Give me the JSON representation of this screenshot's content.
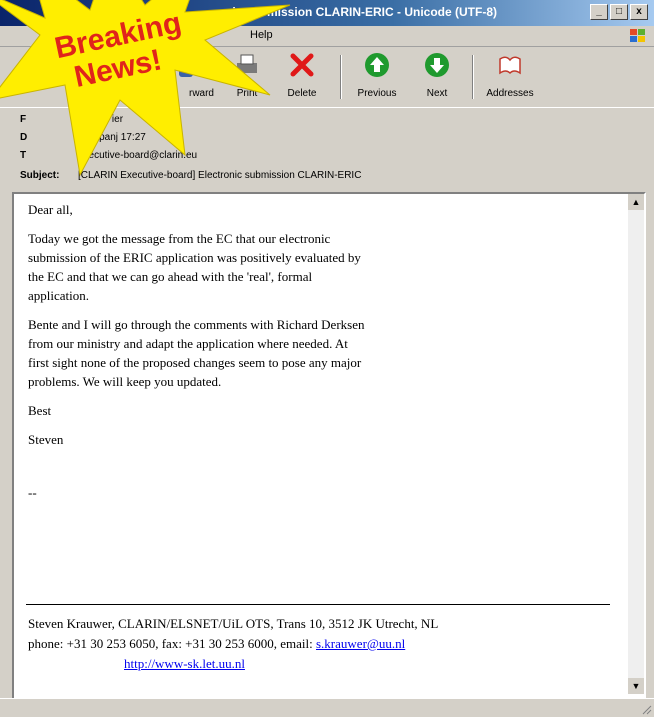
{
  "window": {
    "title": "nic submission CLARIN-ERIC - Unicode (UTF-8)",
    "controls": [
      "_",
      "□",
      "x"
    ]
  },
  "menu": {
    "help": "Help"
  },
  "toolbar": {
    "forward": "rward",
    "print": "Print",
    "delete": "Delete",
    "previous": "Previous",
    "next": "Next",
    "addresses": "Addresses"
  },
  "headers": {
    "from_key": "F",
    "from_value": "Steven          ier",
    "date_key": "D",
    "date_value": "27. lipanj        17:27",
    "to_key": "T",
    "to_value": "executive-board@clarin.eu",
    "subject_key": "Subject:",
    "subject_value": "[CLARIN Executive-board] Electronic submission CLARIN-ERIC"
  },
  "body": {
    "greeting": "Dear all,",
    "p1": "Today we got the message from the EC that our electronic\nsubmission of the ERIC application was positively evaluated by\nthe EC and that we can go ahead with the 'real', formal\napplication.",
    "p2": "Bente and I will go through the comments with Richard Derksen\nfrom our ministry and adapt the application where needed. At\nfirst sight none of the proposed changes seem to pose any major\nproblems. We will keep you updated.",
    "closing": "Best",
    "name": "Steven",
    "dashes": "--",
    "sig_line1": "Steven Krauwer, CLARIN/ELSNET/UiL OTS, Trans 10, 3512 JK Utrecht, NL",
    "sig_line2_prefix": "phone: +31 30 253 6050, fax: +31 30 253 6000, email: ",
    "sig_email": "s.krauwer@uu.nl",
    "sig_url": "http://www-sk.let.uu.nl"
  },
  "burst": {
    "line1": "Breaking",
    "line2": "News!",
    "fill": "#ffee00",
    "text_color": "#e0241b"
  }
}
